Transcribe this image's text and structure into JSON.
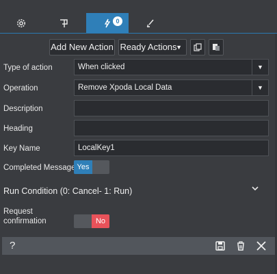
{
  "tabs": [
    {
      "name": "settings",
      "icon": "gear-icon"
    },
    {
      "name": "flag",
      "icon": "flag-icon"
    },
    {
      "name": "actions",
      "icon": "lightning-icon",
      "badge": "0"
    },
    {
      "name": "style",
      "icon": "brush-icon"
    }
  ],
  "toolbar": {
    "add_new_action": "Add New Action",
    "ready_actions": "Ready Actions"
  },
  "form": {
    "type_of_action": {
      "label": "Type of action",
      "value": "When clicked"
    },
    "operation": {
      "label": "Operation",
      "value": "Remove Xpoda Local Data"
    },
    "description": {
      "label": "Description",
      "value": ""
    },
    "heading": {
      "label": "Heading",
      "value": ""
    },
    "key_name": {
      "label": "Key Name",
      "value": "LocalKey1"
    },
    "completed_message": {
      "label": "Completed Message",
      "toggle": "Yes"
    },
    "run_condition": "Run Condition (0: Cancel- 1: Run)",
    "request_confirmation": {
      "label_line1": "Request",
      "label_line2": "confirmation",
      "toggle": "No"
    }
  },
  "footer": {
    "help": "?"
  },
  "colors": {
    "accent": "#2f7fb8",
    "danger": "#e8525a",
    "background": "#3a3c40"
  }
}
